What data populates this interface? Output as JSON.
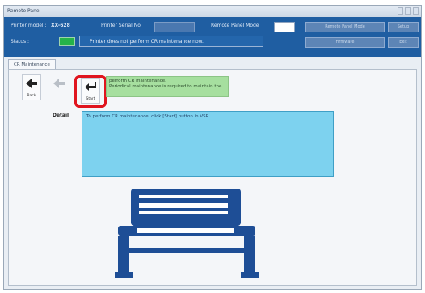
{
  "window": {
    "title": "Remote Panel"
  },
  "header": {
    "printer_model_label": "Printer model :",
    "printer_model_value": "XX-628",
    "serial_label": "Printer Serial No.",
    "remote_mode_label": "Remote Panel Mode",
    "status_label": "Status :",
    "status_text": "Printer does not perform CR maintenance now.",
    "buttons": [
      "Remote Panel Mode",
      "Setup",
      "Firmware",
      "Exit"
    ]
  },
  "tab": {
    "label": "CR Maintenance"
  },
  "toolbar": {
    "back_label": "Back",
    "start_label": "Start"
  },
  "message": {
    "line1": "perform CR maintenance.",
    "line2": "Periodical maintenance is required to maintain the"
  },
  "detail": {
    "label": "Detail",
    "text": "To perform CR maintenance, click [Start] button in VSR."
  },
  "colors": {
    "header_bg": "#1f5ea2",
    "status_ok": "#25b34a",
    "message_bg": "#a6df9f",
    "detail_bg": "#7dd2ef",
    "highlight": "#e0151f",
    "printer": "#1e4e96"
  }
}
